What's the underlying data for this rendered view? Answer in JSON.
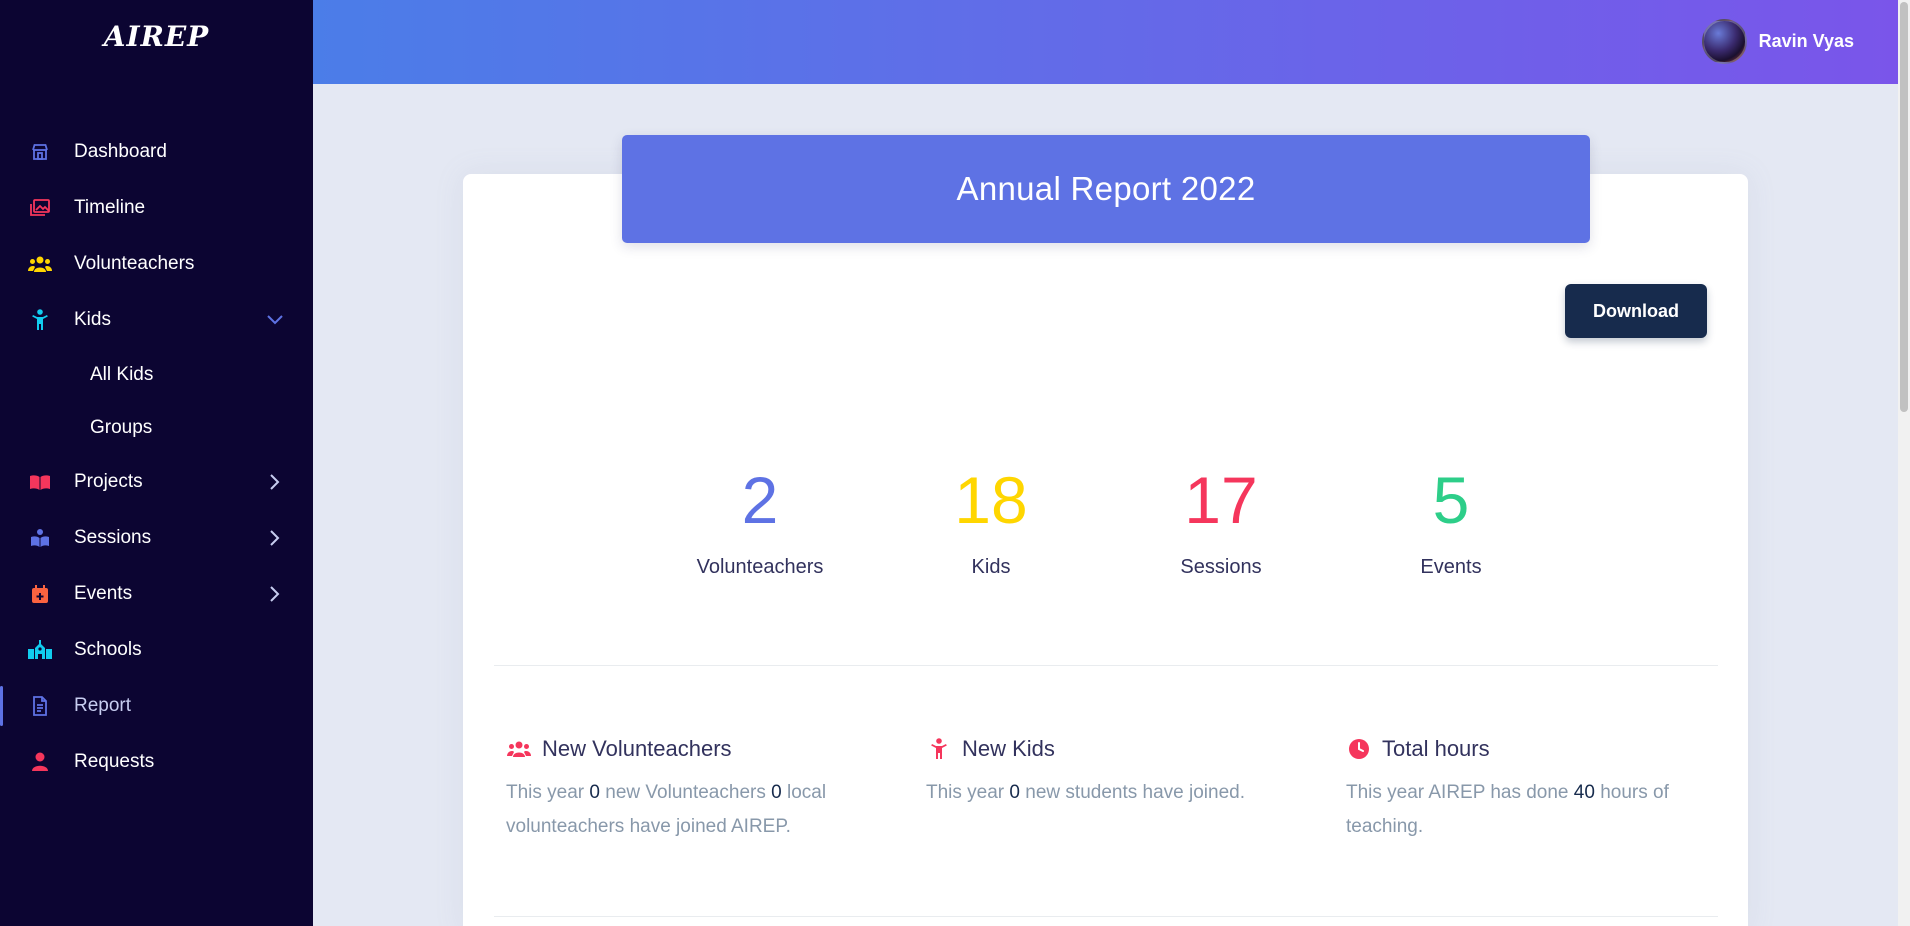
{
  "app": {
    "logo": "AIREP"
  },
  "sidebar": {
    "items": [
      {
        "label": "Dashboard",
        "icon": "shop-icon",
        "color": "#5e72e4"
      },
      {
        "label": "Timeline",
        "icon": "images-icon",
        "color": "#f5365c"
      },
      {
        "label": "Volunteachers",
        "icon": "users-icon",
        "color": "#ffd600"
      },
      {
        "label": "Kids",
        "icon": "child-icon",
        "color": "#11cdef",
        "expanded": true,
        "children": [
          {
            "label": "All Kids"
          },
          {
            "label": "Groups"
          }
        ]
      },
      {
        "label": "Projects",
        "icon": "book-icon",
        "color": "#f5365c"
      },
      {
        "label": "Sessions",
        "icon": "reader-icon",
        "color": "#5e72e4"
      },
      {
        "label": "Events",
        "icon": "calendar-icon",
        "color": "#fb6340"
      },
      {
        "label": "Schools",
        "icon": "school-icon",
        "color": "#11cdef"
      },
      {
        "label": "Report",
        "icon": "document-icon",
        "color": "#5e72e4",
        "active": true
      },
      {
        "label": "Requests",
        "icon": "user-icon",
        "color": "#f5365c"
      }
    ]
  },
  "header": {
    "user_name": "Ravin Vyas"
  },
  "report": {
    "title": "Annual Report 2022",
    "download_label": "Download",
    "stats": [
      {
        "value": "2",
        "label": "Volunteachers",
        "color": "#5e72e4"
      },
      {
        "value": "18",
        "label": "Kids",
        "color": "#ffd600"
      },
      {
        "value": "17",
        "label": "Sessions",
        "color": "#f5365c"
      },
      {
        "value": "5",
        "label": "Events",
        "color": "#2dce89"
      }
    ],
    "info": {
      "volunteachers": {
        "title": "New Volunteachers",
        "t1": "This year ",
        "n1": "0",
        "t2": " new Volunteachers ",
        "n2": "0",
        "t3": " local volunteachers have joined AIREP."
      },
      "kids": {
        "title": "New Kids",
        "t1": "This year ",
        "n1": "0",
        "t2": " new students have joined."
      },
      "hours": {
        "title": "Total hours",
        "t1": "This year AIREP has done ",
        "n1": "40",
        "t2": " hours of teaching."
      }
    }
  }
}
